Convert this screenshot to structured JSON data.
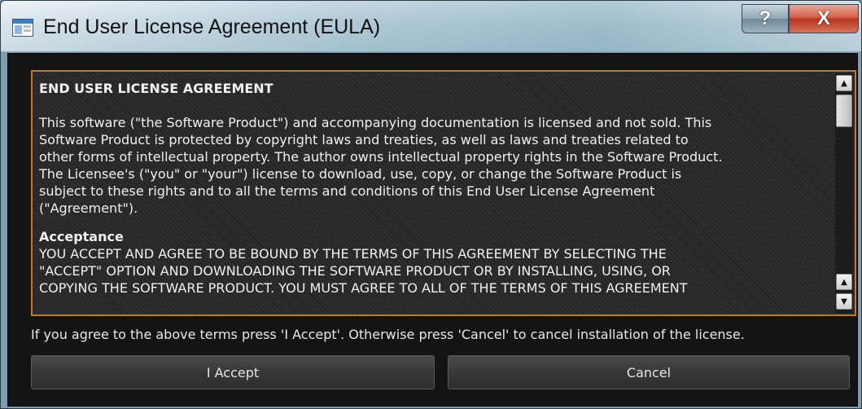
{
  "window": {
    "title": "End User License Agreement (EULA)",
    "help_label": "?",
    "close_label": "X"
  },
  "license": {
    "heading": "END USER LICENSE AGREEMENT",
    "intro_lines": [
      "This software (\"the Software Product\") and accompanying documentation is licensed and not sold. This",
      "Software Product is protected by copyright laws and treaties, as well as laws and treaties related to",
      "other forms of intellectual property. The author owns intellectual property rights in the Software Product.",
      "The Licensee's (\"you\" or \"your\") license to download, use, copy, or change the Software Product is",
      "subject to these rights and to all the terms and conditions of this End User License Agreement",
      "(\"Agreement\")."
    ],
    "acceptance_heading": "Acceptance",
    "acceptance_lines": [
      "YOU ACCEPT AND AGREE TO BE BOUND BY THE TERMS OF THIS AGREEMENT BY SELECTING THE",
      "\"ACCEPT\" OPTION AND DOWNLOADING THE SOFTWARE PRODUCT OR BY INSTALLING, USING, OR",
      "COPYING THE SOFTWARE PRODUCT. YOU MUST AGREE TO ALL OF THE TERMS OF THIS AGREEMENT"
    ]
  },
  "scrollbar": {
    "up_icon": "▲",
    "down_icon": "▼"
  },
  "instruction": "If you agree to the above terms press 'I Accept'. Otherwise press 'Cancel' to cancel installation of the license.",
  "buttons": {
    "accept": "I Accept",
    "cancel": "Cancel"
  },
  "colors": {
    "panel_border": "#c8781e",
    "close_button": "#c84a30"
  }
}
